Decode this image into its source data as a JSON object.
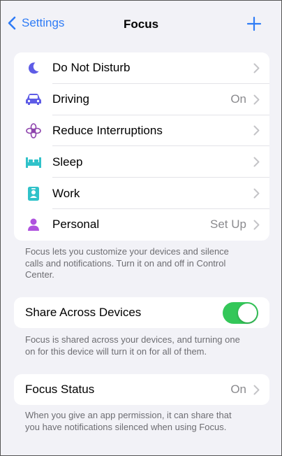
{
  "nav": {
    "back_label": "Settings",
    "title": "Focus",
    "add_icon": "plus-icon"
  },
  "focus_modes": [
    {
      "label": "Do Not Disturb",
      "value": "",
      "icon": "moon-icon",
      "color": "#5e5ce6"
    },
    {
      "label": "Driving",
      "value": "On",
      "icon": "car-icon",
      "color": "#5e5ce6"
    },
    {
      "label": "Reduce Interruptions",
      "value": "",
      "icon": "flower-icon",
      "color": "#8e44ad"
    },
    {
      "label": "Sleep",
      "value": "",
      "icon": "bed-icon",
      "color": "#30c2c9"
    },
    {
      "label": "Work",
      "value": "",
      "icon": "badge-icon",
      "color": "#30c2c9"
    },
    {
      "label": "Personal",
      "value": "Set Up",
      "icon": "person-icon",
      "color": "#af52de"
    }
  ],
  "focus_note": "Focus lets you customize your devices and silence calls and notifications. Turn it on and off in Control Center.",
  "share": {
    "label": "Share Across Devices",
    "enabled": true,
    "note": "Focus is shared across your devices, and turning one on for this device will turn it on for all of them."
  },
  "status": {
    "label": "Focus Status",
    "value": "On",
    "note": "When you give an app permission, it can share that you have notifications silenced when using Focus."
  },
  "colors": {
    "accent": "#2f7cf6",
    "toggle_on": "#34c759"
  }
}
